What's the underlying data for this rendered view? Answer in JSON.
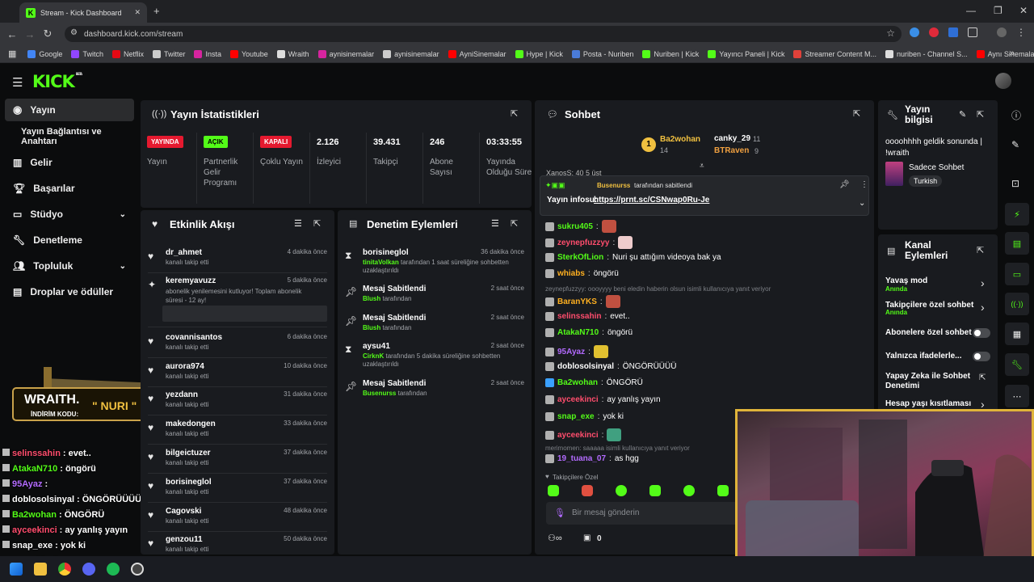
{
  "browser": {
    "tab_title": "Stream - Kick Dashboard",
    "url": "dashboard.kick.com/stream",
    "bookmarks": [
      {
        "label": "Google",
        "color": "#4285f4"
      },
      {
        "label": "Twitch",
        "color": "#9146ff"
      },
      {
        "label": "Netflix",
        "color": "#e50914"
      },
      {
        "label": "Twitter",
        "color": "#cccccc"
      },
      {
        "label": "Insta",
        "color": "#d6249f"
      },
      {
        "label": "Youtube",
        "color": "#ff0000"
      },
      {
        "label": "Wraith",
        "color": "#dddddd"
      },
      {
        "label": "aynisinemalar",
        "color": "#d6249f"
      },
      {
        "label": "aynisinemalar",
        "color": "#cccccc"
      },
      {
        "label": "AyniSinemalar",
        "color": "#ff0000"
      },
      {
        "label": "Hype | Kick",
        "color": "#53fc18"
      },
      {
        "label": "Posta - Nuriben",
        "color": "#4a7bd8"
      },
      {
        "label": "Nuriben | Kick",
        "color": "#53fc18"
      },
      {
        "label": "Yayıncı Paneli | Kick",
        "color": "#53fc18"
      },
      {
        "label": "Streamer Content M...",
        "color": "#e0413a"
      },
      {
        "label": "nuriben - Channel S...",
        "color": "#dddddd"
      },
      {
        "label": "Aynı Sinemalar - Ça...",
        "color": "#ff0000"
      }
    ],
    "more": "»"
  },
  "brand": {
    "logo": "KICK",
    "beta": "BETA"
  },
  "sidebar": {
    "items": [
      {
        "label": "Yayın",
        "icon": "broadcast-icon"
      },
      {
        "label": "Yayın Bağlantısı ve Anahtarı",
        "icon": ""
      },
      {
        "label": "Gelir",
        "icon": "revenue-icon"
      },
      {
        "label": "Başarılar",
        "icon": "trophy-icon"
      },
      {
        "label": "Stüdyo",
        "icon": "studio-icon"
      },
      {
        "label": "Denetleme",
        "icon": "wrench-icon"
      },
      {
        "label": "Topluluk",
        "icon": "community-icon"
      },
      {
        "label": "Droplar ve ödüller",
        "icon": "drops-icon"
      }
    ]
  },
  "stats": {
    "title": "Yayın İstatistikleri",
    "items": [
      {
        "badge": "YAYINDA",
        "badge_color": "#e5192f",
        "label": "Yayın"
      },
      {
        "badge": "AÇIK",
        "badge_color": "#53fc18",
        "label": "Partnerlik Gelir Programı"
      },
      {
        "badge": "KAPALI",
        "badge_color": "#e5192f",
        "label": "Çoklu Yayın"
      },
      {
        "value": "2.126",
        "label": "İzleyici"
      },
      {
        "value": "39.431",
        "label": "Takipçi"
      },
      {
        "value": "246",
        "label": "Abone Sayısı"
      },
      {
        "value": "03:33:55",
        "label": "Yayında Olduğu Süre"
      }
    ]
  },
  "activity": {
    "title": "Etkinlik Akışı",
    "events": [
      {
        "name": "dr_ahmet",
        "sub": "kanalı takip etti",
        "time": "4 dakika önce"
      },
      {
        "name": "keremyavuzz",
        "sub": "abonelik yenilemesini kutluyor! Toplam abonelik süresi - 12 ay!",
        "time": "5 dakika önce"
      },
      {
        "name": "covannisantos",
        "sub": "kanalı takip etti",
        "time": "6 dakika önce"
      },
      {
        "name": "aurora974",
        "sub": "kanalı takip etti",
        "time": "10 dakika önce"
      },
      {
        "name": "yezdann",
        "sub": "kanalı takip etti",
        "time": "31 dakika önce"
      },
      {
        "name": "makedongen",
        "sub": "kanalı takip etti",
        "time": "33 dakika önce"
      },
      {
        "name": "bilgeictuzer",
        "sub": "kanalı takip etti",
        "time": "37 dakika önce"
      },
      {
        "name": "borisineglol",
        "sub": "kanalı takip etti",
        "time": "37 dakika önce"
      },
      {
        "name": "Cagovski",
        "sub": "kanalı takip etti",
        "time": "48 dakika önce"
      },
      {
        "name": "genzou11",
        "sub": "kanalı takip etti",
        "time": "50 dakika önce"
      }
    ]
  },
  "moderation": {
    "title": "Denetim Eylemleri",
    "actions": [
      {
        "name": "borisineglol",
        "actor": "tinitaVolkan",
        "rest": "tarafından 1 saat süreliğine sohbetten uzaklaştırıldı",
        "time": "36 dakika önce"
      },
      {
        "name": "Mesaj Sabitlendi",
        "actor": "Blush",
        "rest": "tarafından",
        "time": "2 saat önce"
      },
      {
        "name": "Mesaj Sabitlendi",
        "actor": "Blush",
        "rest": "tarafından",
        "time": "2 saat önce"
      },
      {
        "name": "aysu41",
        "actor": "CirknK",
        "rest": "tarafından 5 dakika süreliğine sohbetten uzaklaştırıldı",
        "time": "2 saat önce"
      },
      {
        "name": "Mesaj Sabitlendi",
        "actor": "Busenurss",
        "rest": "tarafından",
        "time": "2 saat önce"
      }
    ]
  },
  "chat": {
    "title": "Sohbet",
    "top_gifters": [
      {
        "rank": "1",
        "name": "Ba2wohan",
        "count": "14"
      },
      {
        "name": "canky_29",
        "count": "11"
      },
      {
        "name": "BTRaven",
        "count": "9"
      }
    ],
    "partial_line": "XanosS: 40 5 üst",
    "pinned": {
      "by": "Busenurss",
      "by_suffix": "tarafından sabitlendi",
      "label": "Yayın infosu:",
      "link": "https://prnt.sc/CSNwap0Ru-Je"
    },
    "messages": [
      {
        "user": "sukru405",
        "color": "#53fc18",
        "text": ""
      },
      {
        "user": "zeynepfuzzyy",
        "color": "#ff4d6d",
        "text": ""
      },
      {
        "user": "SterkOfLion",
        "color": "#53fc18",
        "text": "Nuri şu attığım videoya bak ya"
      },
      {
        "user": "whiabs",
        "color": "#ffb020",
        "text": "öngörü"
      },
      {
        "reply": "zeynepfuzzyy: oooyyyy beni eledin haberin olsun isimli kullanıcıya yanıt veriyor"
      },
      {
        "user": "BaranYKS",
        "color": "#ffb020",
        "text": ""
      },
      {
        "user": "selinssahin",
        "color": "#ff4d6d",
        "text": "evet.."
      },
      {
        "user": "AtakaN710",
        "color": "#53fc18",
        "text": "öngörü"
      },
      {
        "user": "95Ayaz",
        "color": "#b36bff",
        "text": ""
      },
      {
        "user": "doblosolsinyal",
        "color": "#ffffff",
        "text": "ÖNGÖRÜÜÜÜ"
      },
      {
        "user": "Ba2wohan",
        "color": "#53fc18",
        "text": "ÖNGÖRÜ"
      },
      {
        "user": "ayceekinci",
        "color": "#ff4d6d",
        "text": "ay yanlış yayın"
      },
      {
        "user": "snap_exe",
        "color": "#53fc18",
        "text": "yok ki"
      },
      {
        "user": "ayceekinci",
        "color": "#ff4d6d",
        "text": ""
      },
      {
        "reply": "merimomen: saaaaa isimli kullanıcıya yanıt veriyor"
      },
      {
        "user": "19_tuana_07",
        "color": "#b36bff",
        "text": "as hgg"
      }
    ],
    "emote_label": "Takipçilere Özel",
    "input_placeholder": "Bir mesaj gönderin",
    "footer_count": "0"
  },
  "stream_info": {
    "title": "Yayın bilgisi",
    "text": "oooohhhh geldik sonunda | !wraith",
    "category": "Sadece Sohbet",
    "tag": "Turkish"
  },
  "channel_actions": {
    "title": "Kanal Eylemleri",
    "rows": [
      {
        "label": "Yavaş mod",
        "sub": "Anında",
        "control": "chevron"
      },
      {
        "label": "Takipçilere özel sohbet",
        "sub": "Anında",
        "control": "chevron"
      },
      {
        "label": "Abonelere özel sohbet",
        "control": "toggle"
      },
      {
        "label": "Yalnızca ifadelerle...",
        "control": "toggle"
      },
      {
        "label": "Yapay Zeka ile Sohbet Denetimi",
        "control": "external"
      },
      {
        "label": "Hesap yaşı kısıtlaması",
        "control": "chevron"
      }
    ]
  },
  "overlay": {
    "sponsor": "WRAITH.",
    "code_label": "İNDİRİM KODU:",
    "code": "\" NURI \"",
    "chat": [
      {
        "user": "selinssahin",
        "color": "#ff4d6d",
        "text": ": evet.."
      },
      {
        "user": "AtakaN710",
        "color": "#53fc18",
        "text": ": öngörü"
      },
      {
        "user": "95Ayaz",
        "color": "#b36bff",
        "text": ":"
      },
      {
        "user": "doblosolsinyal",
        "color": "#ffffff",
        "text": ": ÖNGÖRÜÜÜÜ"
      },
      {
        "user": "Ba2wohan",
        "color": "#53fc18",
        "text": ": ÖNGÖRÜ"
      },
      {
        "user": "ayceekinci",
        "color": "#ff4d6d",
        "text": ": ay yanlış yayın"
      },
      {
        "user": "snap_exe",
        "color": "#ffffff",
        "text": ": yok ki"
      },
      {
        "user": "ayceekinci",
        "color": "#ff4d6d",
        "text": ":"
      }
    ]
  },
  "colors": {
    "accent": "#53fc18",
    "panel": "#191b1f",
    "webcam_border": "#e0b43a"
  }
}
